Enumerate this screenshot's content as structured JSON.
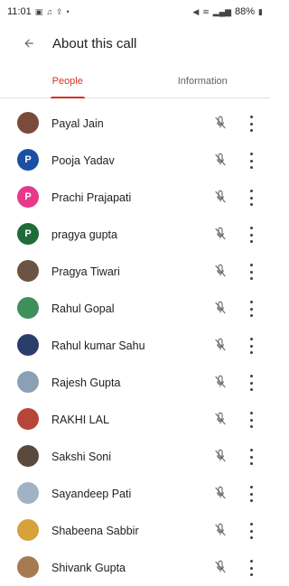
{
  "status_bar": {
    "time": "11:01",
    "battery": "88%"
  },
  "header": {
    "title": "About this call"
  },
  "tabs": [
    {
      "label": "People"
    },
    {
      "label": "Information"
    }
  ],
  "participants": [
    {
      "name": "Payal Jain",
      "initial": "",
      "avatar_color": "#7a4a3a"
    },
    {
      "name": "Pooja Yadav",
      "initial": "P",
      "avatar_color": "#1a4fa3"
    },
    {
      "name": "Prachi Prajapati",
      "initial": "P",
      "avatar_color": "#e8388a"
    },
    {
      "name": "pragya gupta",
      "initial": "P",
      "avatar_color": "#1f6b3a"
    },
    {
      "name": "Pragya Tiwari",
      "initial": "",
      "avatar_color": "#6b5443"
    },
    {
      "name": "Rahul Gopal",
      "initial": "",
      "avatar_color": "#3f8f5c"
    },
    {
      "name": "Rahul kumar Sahu",
      "initial": "",
      "avatar_color": "#2b3d6b"
    },
    {
      "name": "Rajesh Gupta",
      "initial": "",
      "avatar_color": "#8aa0b5"
    },
    {
      "name": "RAKHI LAL",
      "initial": "",
      "avatar_color": "#b8453a"
    },
    {
      "name": "Sakshi Soni",
      "initial": "",
      "avatar_color": "#5a4a3e"
    },
    {
      "name": "Sayandeep Pati",
      "initial": "",
      "avatar_color": "#9fb3c4"
    },
    {
      "name": "Shabeena Sabbir",
      "initial": "",
      "avatar_color": "#d9a13a"
    },
    {
      "name": "Shivank Gupta",
      "initial": "",
      "avatar_color": "#a87a52"
    }
  ]
}
